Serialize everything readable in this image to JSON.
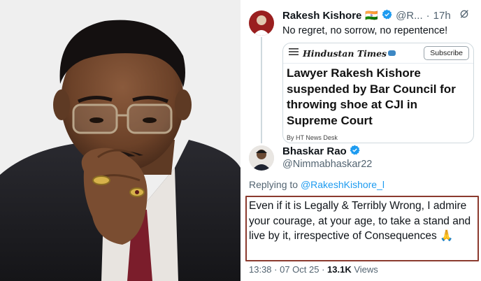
{
  "tweet1": {
    "name": "Rakesh Kishore",
    "flag": "🇮🇳",
    "handle": "@R...",
    "time": "17h",
    "text": "No regret, no sorrow, no repentence!"
  },
  "card": {
    "brand": "Hindustan Times",
    "subscribe_label": "Subscribe",
    "headline": "Lawyer Rakesh Kishore suspended by Bar Council for throwing shoe at CJI in Supreme Court",
    "byline": "By HT News Desk"
  },
  "tweet2": {
    "name": "Bhaskar Rao",
    "handle": "@Nimmabhaskar22",
    "replying_prefix": "Replying to",
    "replying_handle": "@RakeshKishore_l",
    "text": "Even if it is Legally & Terribly Wrong, I admire your courage, at your age, to take a stand and live by it, irrespective of Consequences 🙏",
    "time": "13:38 · 07 Oct 25",
    "views_count": "13.1K",
    "views_label": "Views"
  },
  "colors": {
    "verified": "#1d9bf0",
    "highlight_border": "#8b3a2e"
  }
}
